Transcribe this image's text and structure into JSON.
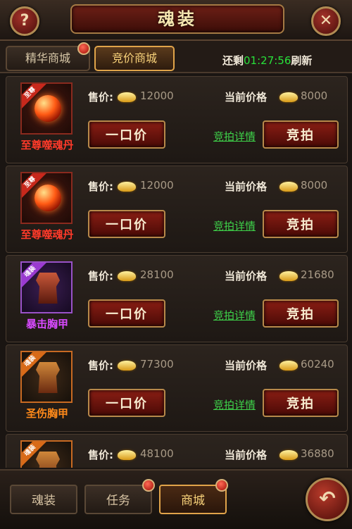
{
  "header": {
    "title": "魂装",
    "help_icon": "?",
    "close_icon": "✕"
  },
  "tabs": [
    {
      "label": "精华商城",
      "active": false,
      "badge": true
    },
    {
      "label": "竞价商城",
      "active": true,
      "badge": false
    }
  ],
  "refresh": {
    "prefix": "还剩",
    "time": "01:27:56",
    "suffix": "刷新"
  },
  "labels": {
    "price": "售价:",
    "current_price": "当前价格",
    "buyout": "一口价",
    "bid": "竞拍",
    "detail": "竞拍详情"
  },
  "items": [
    {
      "name": "至尊噬魂丹",
      "tag": "至尊",
      "price": "12000",
      "current": "8000",
      "rarity": "red",
      "icon": "orb-icon"
    },
    {
      "name": "至尊噬魂丹",
      "tag": "至尊",
      "price": "12000",
      "current": "8000",
      "rarity": "red",
      "icon": "orb-icon"
    },
    {
      "name": "暴击胸甲",
      "tag": "魂装",
      "price": "28100",
      "current": "21680",
      "rarity": "purple",
      "icon": "chestplate-icon"
    },
    {
      "name": "圣伤胸甲",
      "tag": "魂装",
      "price": "77300",
      "current": "60240",
      "rarity": "orange",
      "icon": "chestplate-icon"
    },
    {
      "name": "",
      "tag": "魂装",
      "price": "48100",
      "current": "36880",
      "rarity": "orange",
      "icon": "chestplate-icon"
    }
  ],
  "bottom_nav": [
    {
      "label": "魂装",
      "active": false,
      "badge": false
    },
    {
      "label": "任务",
      "active": false,
      "badge": true
    },
    {
      "label": "商城",
      "active": true,
      "badge": true
    }
  ],
  "back_icon": "↶",
  "colors": {
    "timer": "#28e03a",
    "detail_link": "#3ed24a",
    "accent_gold": "#e0a44a"
  }
}
